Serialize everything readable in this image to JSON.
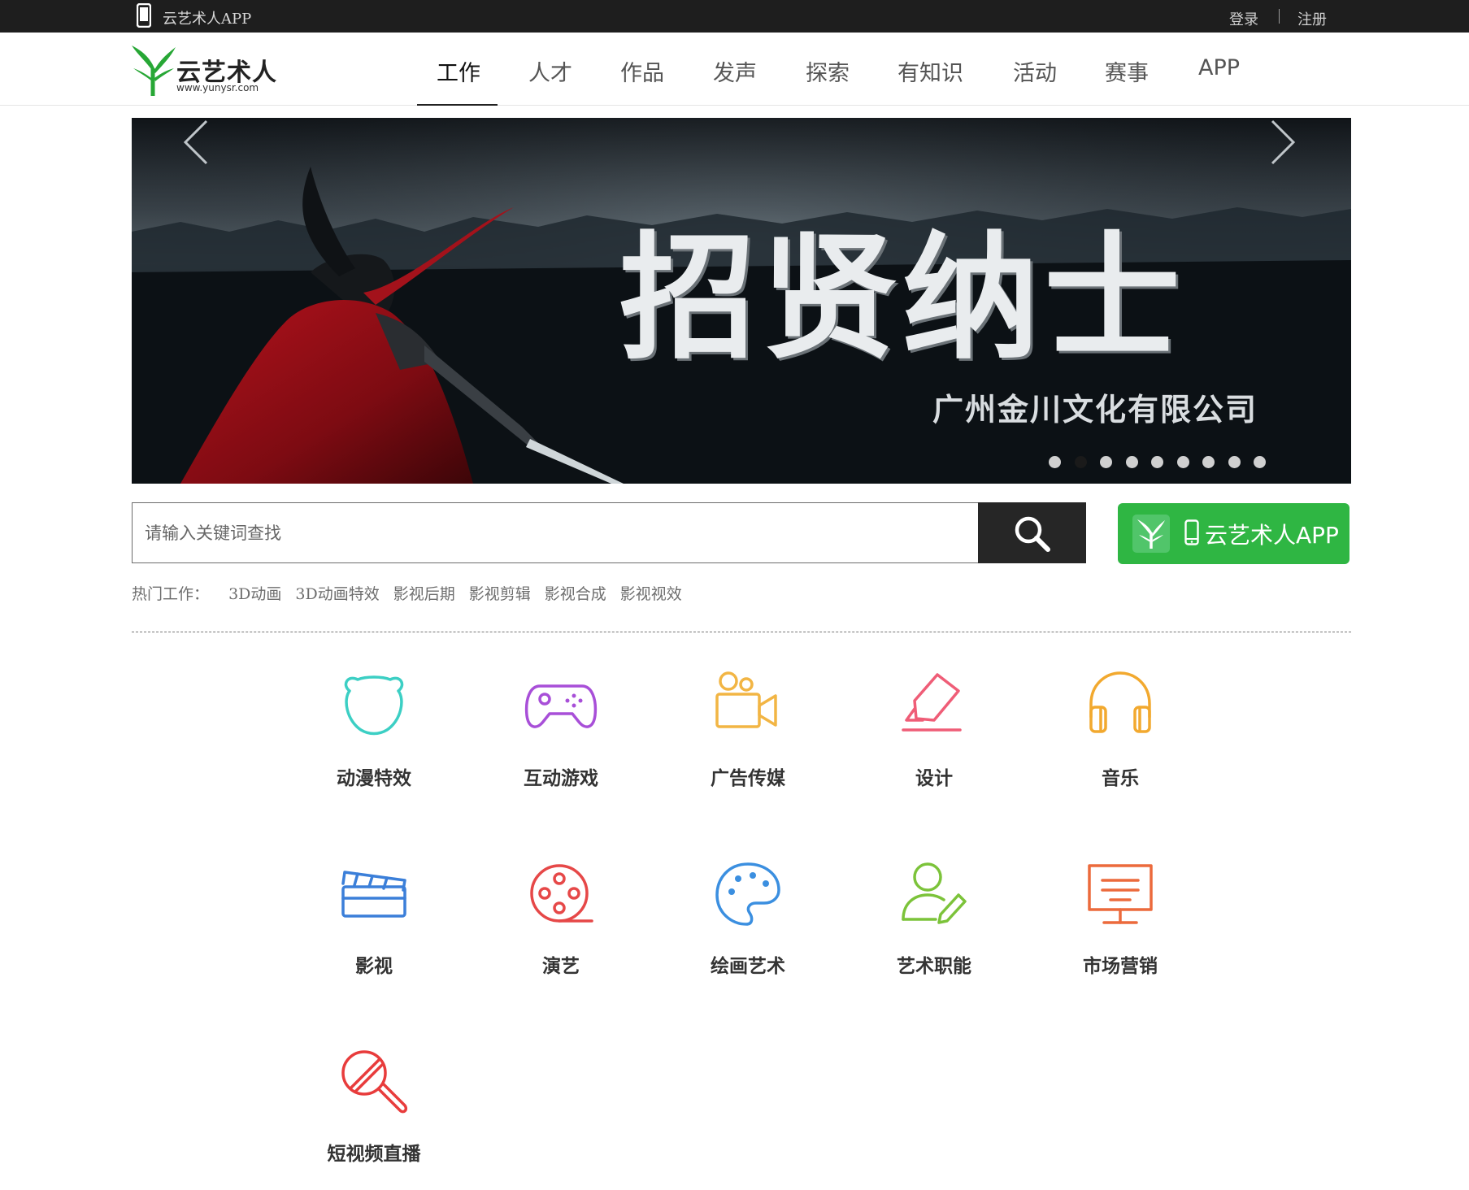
{
  "topbar": {
    "app_text": "云艺术人APP",
    "login": "登录",
    "register": "注册"
  },
  "header": {
    "logo_name": "云艺术人",
    "logo_url": "www.yunysr.com",
    "nav": [
      "工作",
      "人才",
      "作品",
      "发声",
      "探索",
      "有知识",
      "活动",
      "赛事",
      "APP"
    ],
    "active_nav": "工作"
  },
  "banner": {
    "title": "招贤纳士",
    "company": "广州金川文化有限公司",
    "slide_count": 9,
    "active_slide": 2
  },
  "search": {
    "placeholder": "请输入关键词查找",
    "app_button": "云艺术人APP"
  },
  "hot": {
    "label": "热门工作：",
    "tags": [
      "3D动画",
      "3D动画特效",
      "影视后期",
      "影视剪辑",
      "影视合成",
      "影视视效"
    ]
  },
  "categories": [
    {
      "label": "动漫特效",
      "icon": "bear-face-icon",
      "color": "#3ccfc4"
    },
    {
      "label": "互动游戏",
      "icon": "gamepad-icon",
      "color": "#a84fd8"
    },
    {
      "label": "广告传媒",
      "icon": "video-camera-icon",
      "color": "#f2b544"
    },
    {
      "label": "设计",
      "icon": "highlighter-icon",
      "color": "#ef5d77"
    },
    {
      "label": "音乐",
      "icon": "headphones-icon",
      "color": "#f2a92f"
    },
    {
      "label": "影视",
      "icon": "clapperboard-icon",
      "color": "#3b7fd9"
    },
    {
      "label": "演艺",
      "icon": "film-reel-icon",
      "color": "#e64848"
    },
    {
      "label": "绘画艺术",
      "icon": "palette-icon",
      "color": "#3b8fe0"
    },
    {
      "label": "艺术职能",
      "icon": "user-edit-icon",
      "color": "#7cc33a"
    },
    {
      "label": "市场营销",
      "icon": "monitor-icon",
      "color": "#ec6a3c"
    },
    {
      "label": "短视频直播",
      "icon": "microphone-icon",
      "color": "#e83c3c"
    }
  ],
  "colors": {
    "topbar_bg": "#1e1e1e",
    "accent_green": "#2fb643",
    "logo_green": "#27a735"
  }
}
